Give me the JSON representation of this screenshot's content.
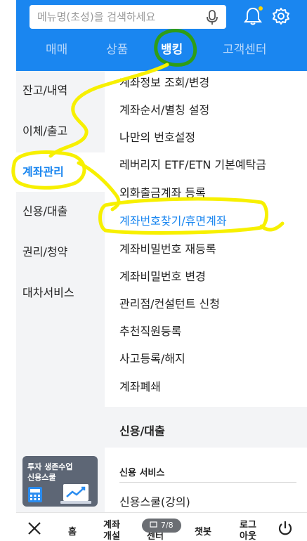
{
  "search": {
    "placeholder": "메뉴명(초성)을 검색하세요"
  },
  "tabs": [
    {
      "label": "매매"
    },
    {
      "label": "상품"
    },
    {
      "label": "뱅킹"
    },
    {
      "label": "고객센터"
    }
  ],
  "sidebar": {
    "items": [
      {
        "label": "잔고/내역"
      },
      {
        "label": "이체/출고"
      },
      {
        "label": "계좌관리"
      },
      {
        "label": "신용/대출"
      },
      {
        "label": "권리/청약"
      },
      {
        "label": "대차서비스"
      }
    ],
    "promo": "투자 생존수업\n신용스쿨"
  },
  "menu": {
    "items": [
      "계좌정보 조회/변경",
      "계좌순서/별칭 설정",
      "나만의 번호설정",
      "레버리지 ETF/ETN 기본예탁금",
      "외화출금계좌 등록",
      "계좌번호찾기/휴면계좌",
      "계좌비밀번호 재등록",
      "계좌비밀번호 변경",
      "관리점/컨설턴트 신청",
      "추천직원등록",
      "사고등록/해지",
      "계좌폐쇄"
    ],
    "section_title": "신용/대출",
    "subsection": "신용 서비스",
    "sub_items": [
      "신용스쿨(강의)"
    ]
  },
  "bottom": {
    "home": "홈",
    "account": "계좌\n개설",
    "center": "센터",
    "chatbot": "챗봇",
    "logout": "로그\n아웃",
    "page_indicator": "7/8"
  },
  "colors": {
    "accent": "#1a86f0",
    "annotation_yellow": "#f7f000",
    "annotation_green": "#2f9d16"
  },
  "icons": [
    "mic-icon",
    "bell-icon",
    "gear-icon",
    "close-icon",
    "power-icon"
  ]
}
